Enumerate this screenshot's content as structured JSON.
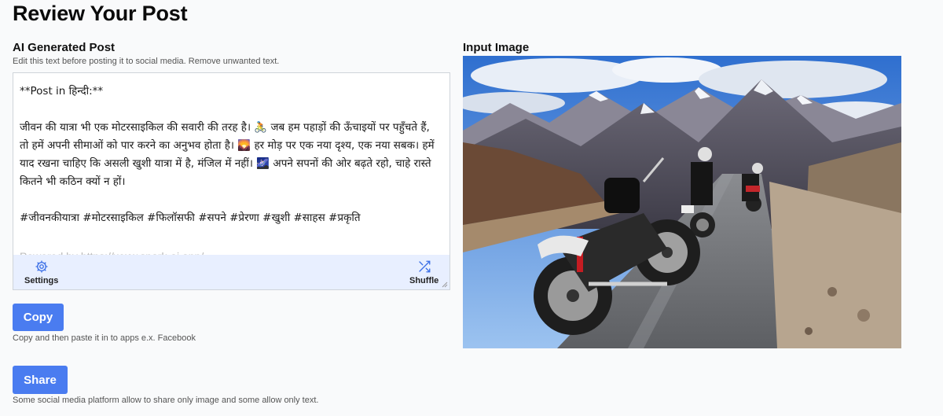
{
  "page": {
    "title": "Review Your Post"
  },
  "post_section": {
    "title": "AI Generated Post",
    "hint": "Edit this text before posting it to social media. Remove unwanted text.",
    "text": "**Post in हिन्दी:**\n\nजीवन की यात्रा भी एक मोटरसाइकिल की सवारी की तरह है। 🚴 जब हम पहाड़ों की ऊँचाइयों पर पहुँचते हैं, तो हमें अपनी सीमाओं को पार करने का अनुभव होता है। 🌄 हर मोड़ पर एक नया दृश्य, एक नया सबक। हमें याद रखना चाहिए कि असली खुशी यात्रा में है, मंजिल में नहीं। 🌌 अपने सपनों की ओर बढ़ते रहो, चाहे रास्ते कितने भी कठिन क्यों न हों।\n\n#जीवनकीयात्रा #मोटरसाइकिल #फिलॉसफी #सपने #प्रेरणा #खुशी #साहस #प्रकृति",
    "powered_by": "Powered by https://www.spark-ai.app/",
    "toolbar": {
      "settings_label": "Settings",
      "settings_icon": "gear-icon",
      "shuffle_label": "Shuffle",
      "shuffle_icon": "shuffle-icon"
    }
  },
  "copy": {
    "button_label": "Copy",
    "hint": "Copy and then paste it in to apps e.x. Facebook"
  },
  "share": {
    "button_label": "Share",
    "hint": "Some social media platform allow to share only image and some allow only text."
  },
  "image_section": {
    "title": "Input Image"
  },
  "colors": {
    "accent": "#4a7cf0",
    "toolbar_bg": "#e8efff"
  }
}
